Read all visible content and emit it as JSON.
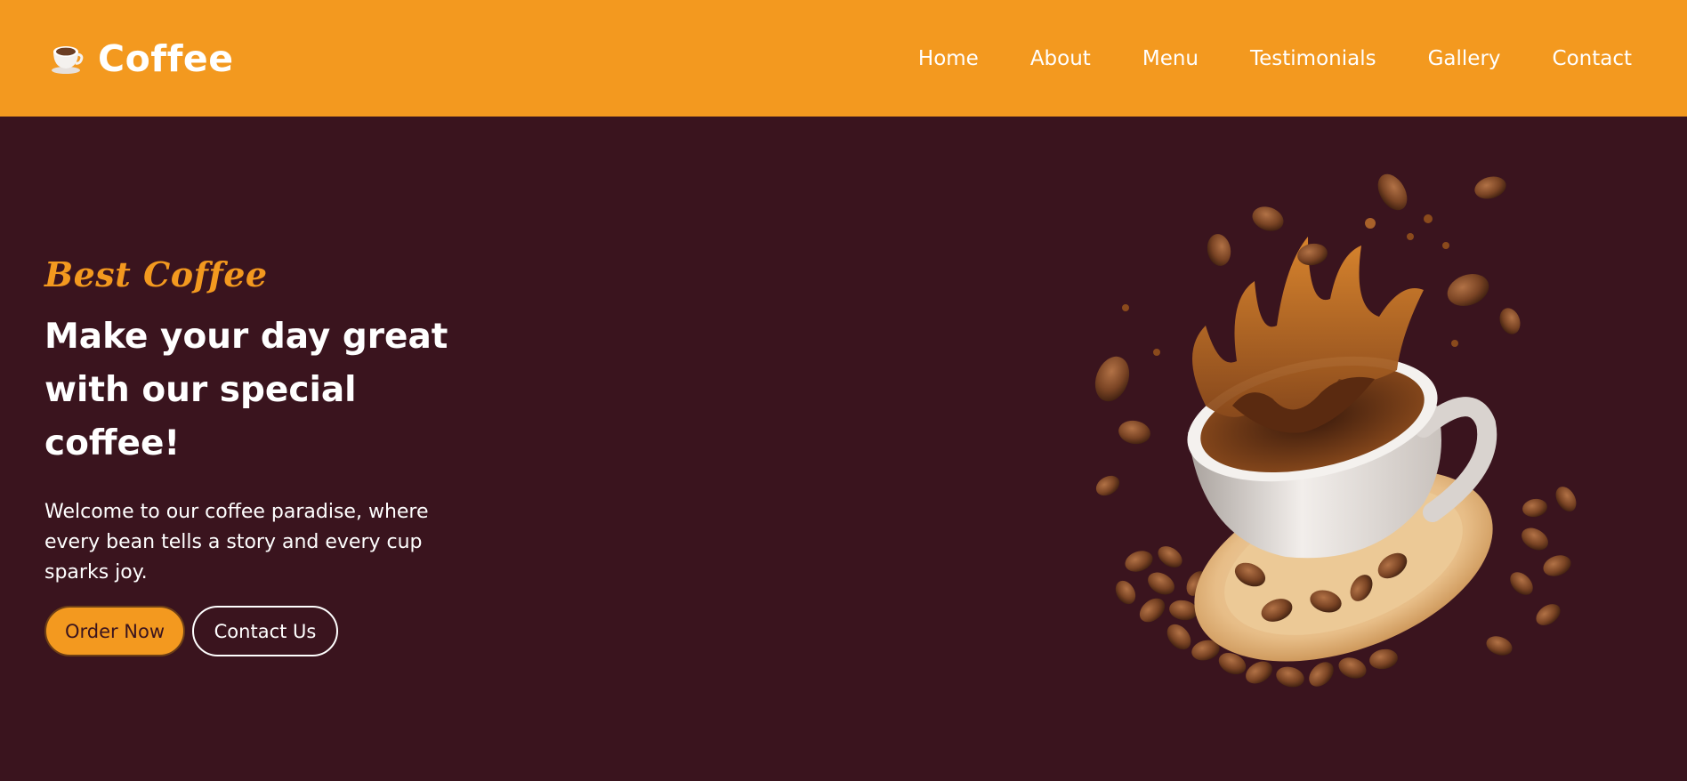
{
  "header": {
    "brand_name": "Coffee",
    "brand_icon": "coffee-cup-icon",
    "background": "#f3991f",
    "nav": [
      {
        "label": "Home"
      },
      {
        "label": "About"
      },
      {
        "label": "Menu"
      },
      {
        "label": "Testimonials"
      },
      {
        "label": "Gallery"
      },
      {
        "label": "Contact"
      }
    ]
  },
  "hero": {
    "background": "#3a141e",
    "tagline": "Best Coffee",
    "headline": "Make your day great with our special coffee!",
    "description": "Welcome to our coffee paradise, where every bean tells a story and every cup sparks joy.",
    "primary_button": "Order Now",
    "secondary_button": "Contact Us",
    "image": "coffee-cup-splash-with-beans"
  },
  "colors": {
    "accent": "#f3991f",
    "dark": "#3a141e",
    "text": "#ffffff"
  }
}
